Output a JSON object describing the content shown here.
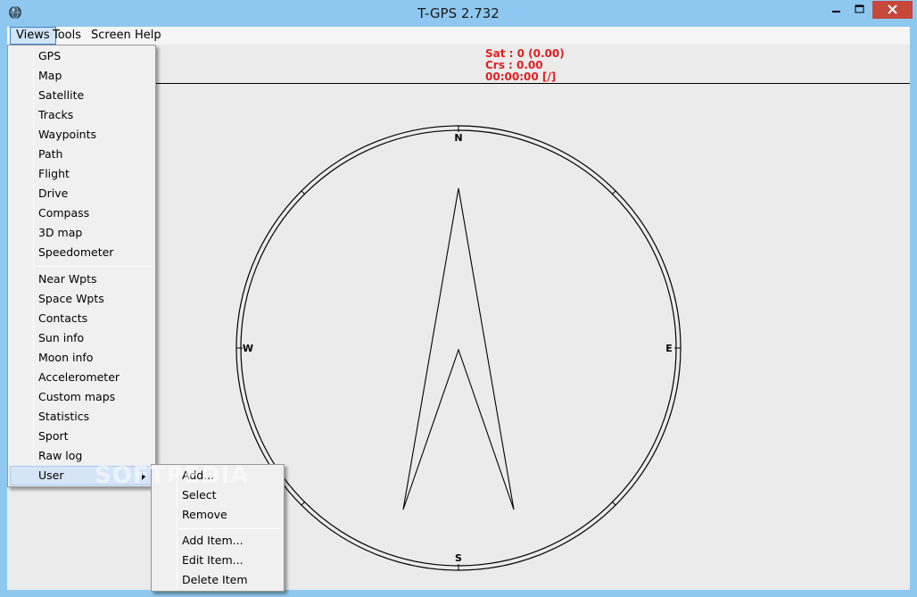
{
  "window": {
    "title": "T-GPS 2.732"
  },
  "menubar": {
    "items": [
      "Views",
      "Tools",
      "Screen",
      "Help"
    ]
  },
  "readout": {
    "sat": "Sat : 0 (0.00)",
    "crs": "Crs : 0.00",
    "time": "00:00:00 [/]"
  },
  "compass": {
    "north": "N",
    "south": "S",
    "east": "E",
    "west": "W"
  },
  "views_menu": {
    "group1": [
      "GPS",
      "Map",
      "Satellite",
      "Tracks",
      "Waypoints",
      "Path",
      "Flight",
      "Drive",
      "Compass",
      "3D map",
      "Speedometer"
    ],
    "group2": [
      "Near Wpts",
      "Space Wpts",
      "Contacts",
      "Sun info",
      "Moon info",
      "Accelerometer",
      "Custom maps",
      "Statistics",
      "Sport",
      "Raw log",
      "User"
    ]
  },
  "user_menu": {
    "group1": [
      "Add...",
      "Select",
      "Remove"
    ],
    "group2": [
      "Add Item...",
      "Edit Item...",
      "Delete Item"
    ]
  },
  "watermark": "SOFTPEDIA"
}
